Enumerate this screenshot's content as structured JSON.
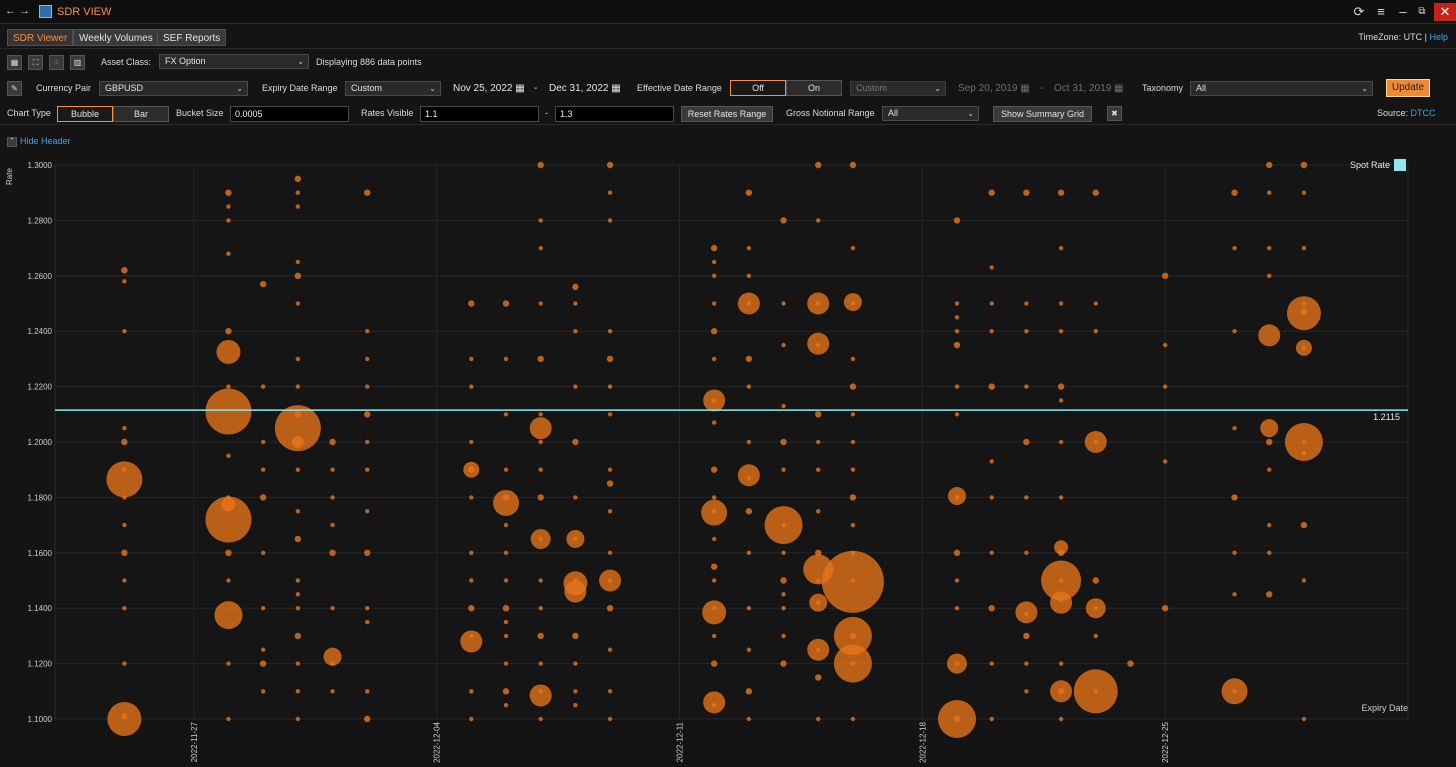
{
  "window": {
    "title": "SDR VIEW",
    "back": "←",
    "forward": "→"
  },
  "tabs": [
    "SDR Viewer",
    "Weekly Volumes",
    "SEF Reports"
  ],
  "header": {
    "timezone": "TimeZone: UTC",
    "separator": "|",
    "help": "Help"
  },
  "row1": {
    "asset_class_label": "Asset Class:",
    "asset_class_value": "FX Option",
    "display_text": "Displaying 886 data points"
  },
  "row2": {
    "currency_pair_label": "Currency Pair",
    "currency_pair_value": "GBPUSD",
    "expiry_date_range_label": "Expiry Date Range",
    "expiry_range_value": "Custom",
    "expiry_start": "Nov 25, 2022",
    "expiry_end": "Dec 31, 2022",
    "dash": "-",
    "effective_date_range_label": "Effective Date Range",
    "off_label": "Off",
    "on_label": "On",
    "effective_range_value": "Custom",
    "effective_start": "Sep 20, 2019",
    "effective_end": "Oct 31, 2019",
    "taxonomy_label": "Taxonomy",
    "taxonomy_value": "All",
    "update_label": "Update"
  },
  "row3": {
    "chart_type_label": "Chart Type",
    "bubble_label": "Bubble",
    "bar_label": "Bar",
    "bucket_size_label": "Bucket Size",
    "bucket_size_value": "0.0005",
    "rates_visible_label": "Rates Visible",
    "rates_min": "1.1",
    "rates_max": "1.3",
    "dash": "-",
    "reset_label": "Reset Rates Range",
    "gross_notional_label": "Gross Notional Range",
    "gross_notional_value": "All",
    "summary_label": "Show Summary Grid",
    "source_label": "Source:",
    "source_value": "DTCC"
  },
  "hide_header": "Hide Header",
  "colors": {
    "accent": "#ff8c3a",
    "bubble": "#e8741a",
    "spot": "#8fe8f0",
    "link": "#3aa7e7"
  },
  "chart_data": {
    "type": "scatter",
    "ylabel": "Rate",
    "xlabel": "Expiry Date",
    "ylim": [
      1.1,
      1.3
    ],
    "xlim": [
      "2022-11-23",
      "2023-01-01"
    ],
    "y_ticks": [
      "1.1000",
      "1.1200",
      "1.1400",
      "1.1600",
      "1.1800",
      "1.2000",
      "1.2200",
      "1.2400",
      "1.2600",
      "1.2800",
      "1.3000"
    ],
    "x_ticks": [
      {
        "date": "2022-11-27",
        "label": "2022-11-27"
      },
      {
        "date": "2022-12-04",
        "label": "2022-12-04"
      },
      {
        "date": "2022-12-11",
        "label": "2022-12-11"
      },
      {
        "date": "2022-12-18",
        "label": "2022-12-18"
      },
      {
        "date": "2022-12-25",
        "label": "2022-12-25"
      }
    ],
    "spot": {
      "name": "Spot Rate",
      "value": 1.2115,
      "label": "1.2115"
    },
    "columns": [
      {
        "date": "2022-11-25",
        "ys": [
          1.262,
          1.258,
          1.24,
          1.205,
          1.2,
          1.19,
          1.18,
          1.17,
          1.16,
          1.15,
          1.14,
          1.12,
          1.101
        ]
      },
      {
        "date": "2022-11-28",
        "ys": [
          1.29,
          1.285,
          1.28,
          1.268,
          1.24,
          1.22,
          1.195,
          1.18,
          1.16,
          1.15,
          1.12,
          1.1
        ]
      },
      {
        "date": "2022-11-29",
        "ys": [
          1.257,
          1.22,
          1.2,
          1.19,
          1.18,
          1.16,
          1.14,
          1.125,
          1.12,
          1.11
        ]
      },
      {
        "date": "2022-11-30",
        "ys": [
          1.295,
          1.29,
          1.285,
          1.265,
          1.26,
          1.25,
          1.23,
          1.22,
          1.21,
          1.2,
          1.19,
          1.175,
          1.165,
          1.15,
          1.145,
          1.14,
          1.13,
          1.12,
          1.11,
          1.1
        ]
      },
      {
        "date": "2022-12-01",
        "ys": [
          1.2,
          1.19,
          1.18,
          1.17,
          1.16,
          1.14,
          1.12,
          1.11
        ]
      },
      {
        "date": "2022-12-02",
        "ys": [
          1.29,
          1.24,
          1.23,
          1.22,
          1.21,
          1.2,
          1.19,
          1.175,
          1.16,
          1.14,
          1.135,
          1.11,
          1.1
        ]
      },
      {
        "date": "2022-12-05",
        "ys": [
          1.25,
          1.23,
          1.22,
          1.2,
          1.19,
          1.18,
          1.16,
          1.15,
          1.14,
          1.13,
          1.11,
          1.1
        ]
      },
      {
        "date": "2022-12-06",
        "ys": [
          1.25,
          1.23,
          1.21,
          1.19,
          1.18,
          1.17,
          1.16,
          1.15,
          1.14,
          1.135,
          1.13,
          1.12,
          1.11,
          1.105
        ]
      },
      {
        "date": "2022-12-07",
        "ys": [
          1.3,
          1.28,
          1.27,
          1.25,
          1.23,
          1.21,
          1.2,
          1.19,
          1.18,
          1.165,
          1.15,
          1.14,
          1.13,
          1.12,
          1.11,
          1.1
        ]
      },
      {
        "date": "2022-12-08",
        "ys": [
          1.256,
          1.25,
          1.24,
          1.22,
          1.2,
          1.18,
          1.165,
          1.15,
          1.13,
          1.12,
          1.11,
          1.105
        ]
      },
      {
        "date": "2022-12-09",
        "ys": [
          1.3,
          1.29,
          1.28,
          1.24,
          1.23,
          1.22,
          1.21,
          1.19,
          1.185,
          1.175,
          1.16,
          1.15,
          1.14,
          1.125,
          1.11,
          1.1
        ]
      },
      {
        "date": "2022-12-12",
        "ys": [
          1.27,
          1.265,
          1.26,
          1.25,
          1.24,
          1.23,
          1.215,
          1.207,
          1.19,
          1.18,
          1.175,
          1.165,
          1.155,
          1.15,
          1.14,
          1.13,
          1.12,
          1.105
        ]
      },
      {
        "date": "2022-12-13",
        "ys": [
          1.29,
          1.27,
          1.26,
          1.25,
          1.23,
          1.22,
          1.2,
          1.187,
          1.175,
          1.16,
          1.14,
          1.125,
          1.11,
          1.1
        ]
      },
      {
        "date": "2022-12-14",
        "ys": [
          1.28,
          1.25,
          1.235,
          1.213,
          1.2,
          1.19,
          1.17,
          1.16,
          1.15,
          1.145,
          1.14,
          1.13,
          1.12
        ]
      },
      {
        "date": "2022-12-15",
        "ys": [
          1.3,
          1.28,
          1.25,
          1.235,
          1.21,
          1.2,
          1.19,
          1.175,
          1.16,
          1.15,
          1.142,
          1.125,
          1.115,
          1.1
        ]
      },
      {
        "date": "2022-12-16",
        "ys": [
          1.3,
          1.27,
          1.25,
          1.23,
          1.22,
          1.21,
          1.2,
          1.19,
          1.18,
          1.17,
          1.16,
          1.15,
          1.13,
          1.12,
          1.1
        ]
      },
      {
        "date": "2022-12-19",
        "ys": [
          1.28,
          1.25,
          1.245,
          1.24,
          1.235,
          1.22,
          1.21,
          1.18,
          1.16,
          1.15,
          1.14,
          1.12,
          1.1
        ]
      },
      {
        "date": "2022-12-20",
        "ys": [
          1.29,
          1.263,
          1.25,
          1.24,
          1.22,
          1.193,
          1.18,
          1.16,
          1.14,
          1.12,
          1.1
        ]
      },
      {
        "date": "2022-12-21",
        "ys": [
          1.29,
          1.25,
          1.24,
          1.22,
          1.2,
          1.18,
          1.16,
          1.138,
          1.13,
          1.12,
          1.11
        ]
      },
      {
        "date": "2022-12-22",
        "ys": [
          1.29,
          1.27,
          1.25,
          1.24,
          1.22,
          1.215,
          1.2,
          1.18,
          1.16,
          1.15,
          1.143,
          1.12,
          1.11,
          1.1
        ]
      },
      {
        "date": "2022-12-23",
        "ys": [
          1.29,
          1.25,
          1.24,
          1.2,
          1.15,
          1.14,
          1.13,
          1.11
        ]
      },
      {
        "date": "2022-12-24",
        "ys": [
          1.12
        ]
      },
      {
        "date": "2022-12-25",
        "ys": [
          1.26,
          1.235,
          1.22,
          1.193,
          1.14
        ]
      },
      {
        "date": "2022-12-27",
        "ys": [
          1.29,
          1.27,
          1.24,
          1.205,
          1.18,
          1.16,
          1.145,
          1.11
        ]
      },
      {
        "date": "2022-12-28",
        "ys": [
          1.3,
          1.29,
          1.27,
          1.26,
          1.2,
          1.19,
          1.17,
          1.16,
          1.145
        ]
      },
      {
        "date": "2022-12-29",
        "ys": [
          1.3,
          1.29,
          1.27,
          1.25,
          1.247,
          1.234,
          1.2,
          1.196,
          1.17,
          1.15,
          1.1
        ]
      }
    ],
    "bubbles": [
      {
        "date": "2022-11-25",
        "y": 1.1865,
        "r": 18
      },
      {
        "date": "2022-11-25",
        "y": 1.1,
        "r": 17
      },
      {
        "date": "2022-11-28",
        "y": 1.2325,
        "r": 12
      },
      {
        "date": "2022-11-28",
        "y": 1.211,
        "r": 23
      },
      {
        "date": "2022-11-28",
        "y": 1.172,
        "r": 23
      },
      {
        "date": "2022-11-28",
        "y": 1.1775,
        "r": 7
      },
      {
        "date": "2022-11-28",
        "y": 1.1375,
        "r": 14
      },
      {
        "date": "2022-11-30",
        "y": 1.205,
        "r": 23
      },
      {
        "date": "2022-11-30",
        "y": 1.2,
        "r": 6
      },
      {
        "date": "2022-12-01",
        "y": 1.1225,
        "r": 9
      },
      {
        "date": "2022-12-05",
        "y": 1.128,
        "r": 11
      },
      {
        "date": "2022-12-05",
        "y": 1.19,
        "r": 8
      },
      {
        "date": "2022-12-06",
        "y": 1.178,
        "r": 13
      },
      {
        "date": "2022-12-07",
        "y": 1.205,
        "r": 11
      },
      {
        "date": "2022-12-07",
        "y": 1.165,
        "r": 10
      },
      {
        "date": "2022-12-07",
        "y": 1.1085,
        "r": 11
      },
      {
        "date": "2022-12-08",
        "y": 1.165,
        "r": 9
      },
      {
        "date": "2022-12-08",
        "y": 1.149,
        "r": 12
      },
      {
        "date": "2022-12-08",
        "y": 1.146,
        "r": 11
      },
      {
        "date": "2022-12-09",
        "y": 1.15,
        "r": 11
      },
      {
        "date": "2022-12-12",
        "y": 1.215,
        "r": 11
      },
      {
        "date": "2022-12-12",
        "y": 1.1745,
        "r": 13
      },
      {
        "date": "2022-12-12",
        "y": 1.1385,
        "r": 12
      },
      {
        "date": "2022-12-12",
        "y": 1.106,
        "r": 11
      },
      {
        "date": "2022-12-13",
        "y": 1.25,
        "r": 11
      },
      {
        "date": "2022-12-13",
        "y": 1.188,
        "r": 11
      },
      {
        "date": "2022-12-14",
        "y": 1.17,
        "r": 19
      },
      {
        "date": "2022-12-15",
        "y": 1.25,
        "r": 11
      },
      {
        "date": "2022-12-15",
        "y": 1.2355,
        "r": 11
      },
      {
        "date": "2022-12-15",
        "y": 1.154,
        "r": 15
      },
      {
        "date": "2022-12-15",
        "y": 1.142,
        "r": 9
      },
      {
        "date": "2022-12-15",
        "y": 1.125,
        "r": 11
      },
      {
        "date": "2022-12-16",
        "y": 1.2505,
        "r": 9
      },
      {
        "date": "2022-12-16",
        "y": 1.1495,
        "r": 31
      },
      {
        "date": "2022-12-16",
        "y": 1.13,
        "r": 19
      },
      {
        "date": "2022-12-16",
        "y": 1.12,
        "r": 19
      },
      {
        "date": "2022-12-19",
        "y": 1.1,
        "r": 19
      },
      {
        "date": "2022-12-19",
        "y": 1.12,
        "r": 10
      },
      {
        "date": "2022-12-19",
        "y": 1.1805,
        "r": 9
      },
      {
        "date": "2022-12-21",
        "y": 1.1385,
        "r": 11
      },
      {
        "date": "2022-12-22",
        "y": 1.15,
        "r": 20
      },
      {
        "date": "2022-12-22",
        "y": 1.142,
        "r": 11
      },
      {
        "date": "2022-12-22",
        "y": 1.11,
        "r": 11
      },
      {
        "date": "2022-12-22",
        "y": 1.162,
        "r": 7
      },
      {
        "date": "2022-12-23",
        "y": 1.2,
        "r": 11
      },
      {
        "date": "2022-12-23",
        "y": 1.11,
        "r": 22
      },
      {
        "date": "2022-12-23",
        "y": 1.14,
        "r": 10
      },
      {
        "date": "2022-12-27",
        "y": 1.11,
        "r": 13
      },
      {
        "date": "2022-12-28",
        "y": 1.2385,
        "r": 11
      },
      {
        "date": "2022-12-28",
        "y": 1.205,
        "r": 9
      },
      {
        "date": "2022-12-29",
        "y": 1.2465,
        "r": 17
      },
      {
        "date": "2022-12-29",
        "y": 1.2,
        "r": 19
      },
      {
        "date": "2022-12-29",
        "y": 1.234,
        "r": 8
      }
    ]
  }
}
